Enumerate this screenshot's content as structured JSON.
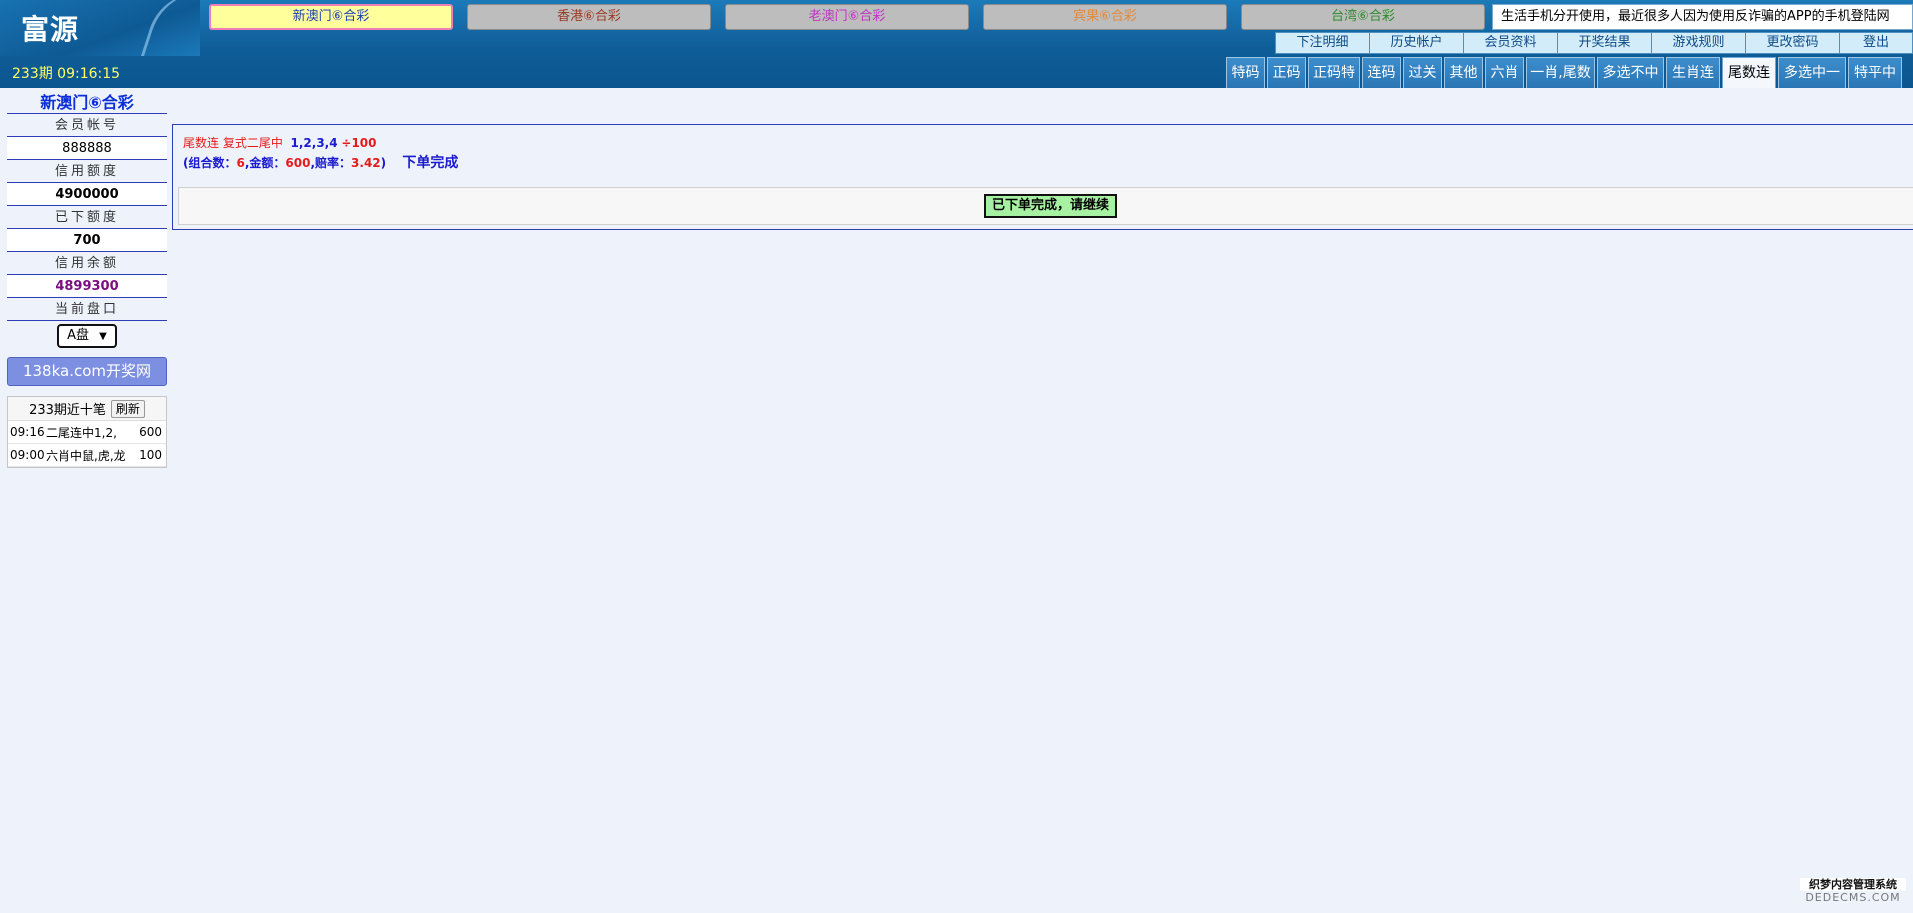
{
  "header": {
    "logo": "富源",
    "period": "233期 09:16:15",
    "ticker": "生活手机分开使用，最近很多人因为使用反诈骗的APP的手机登陆网"
  },
  "lottery_tabs": [
    {
      "label": "新澳门⑥合彩",
      "color": "#1a3fb5"
    },
    {
      "label": "香港⑥合彩",
      "color": "#9b3a24"
    },
    {
      "label": "老澳门⑥合彩",
      "color": "#c233c6"
    },
    {
      "label": "宾果⑥合彩",
      "color": "#e28a3a"
    },
    {
      "label": "台湾⑥合彩",
      "color": "#2e8b2e"
    }
  ],
  "topnav": [
    "下注明细",
    "历史帐户",
    "会员资料",
    "开奖结果",
    "游戏规则",
    "更改密码",
    "登出"
  ],
  "gametabs": [
    "特码",
    "正码",
    "正码特",
    "连码",
    "过关",
    "其他",
    "六肖",
    "一肖,尾数",
    "多选不中",
    "生肖连",
    "尾数连",
    "多选中一",
    "特平中"
  ],
  "active_gametab": "尾数连",
  "sidebar": {
    "title": "新澳门⑥合彩",
    "account_label": "会员帐号",
    "account_value": "888888",
    "credit_label": "信用额度",
    "credit_value": "4900000",
    "placed_label": "已下额度",
    "placed_value": "700",
    "balance_label": "信用余额",
    "balance_value": "4899300",
    "panel_label": "当前盘口",
    "panel_value": "A盘",
    "kaijiang": "138ka.com开奖网",
    "recent_title": "233期近十笔",
    "refresh": "刷新",
    "recent": [
      {
        "time": "09:16",
        "desc": "二尾连中1,2,",
        "amount": "600"
      },
      {
        "time": "09:00",
        "desc": "六肖中鼠,虎,龙",
        "amount": "100"
      }
    ]
  },
  "bet": {
    "type": "尾数连",
    "subtype": "复式二尾中",
    "numbers": "1,2,3,4",
    "amount": "÷100",
    "combo_label": "(组合数：",
    "combo_value": "6",
    "money_label": ",金额：",
    "money_value": "600",
    "odds_label": ",赔率：",
    "odds_value": "3.42",
    "close": ")",
    "done": "下单完成",
    "continue": "已下单完成，请继续"
  },
  "watermark": {
    "line1": "织梦内容管理系统",
    "line2": "DEDECMS.COM"
  }
}
